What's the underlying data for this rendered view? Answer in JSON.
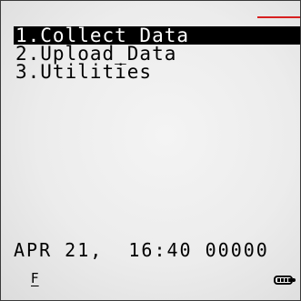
{
  "colors": {
    "status_line": "#d72020",
    "selection_background": "#000000",
    "selection_text": "#ffffff",
    "screen_background": "#ececec"
  },
  "menu": {
    "items": [
      {
        "label": "1.Collect Data",
        "selected": true
      },
      {
        "label": "2.Upload_Data",
        "selected": false
      },
      {
        "label": "3.Utilities",
        "selected": false
      }
    ]
  },
  "status": {
    "datetime": "APR 21,  16:40 00000",
    "function_key": "F",
    "battery_icon": "battery-icon"
  }
}
